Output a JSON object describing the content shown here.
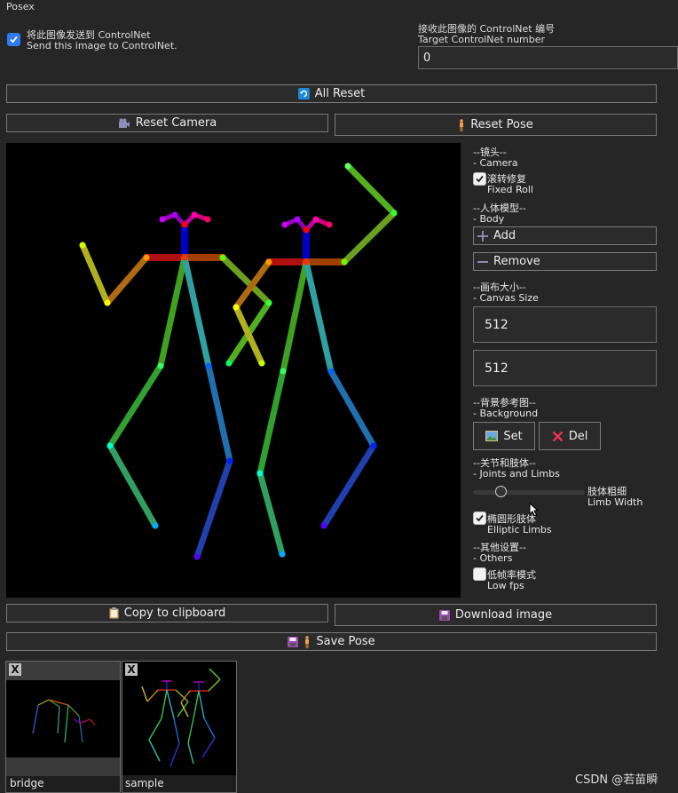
{
  "top": {
    "title_fragment": "Posex",
    "send_checkbox": {
      "label_cn": "将此图像发送到 ControlNet",
      "label_en": "Send this image to ControlNet.",
      "checked": true
    },
    "target_label_cn": "接收此图像的 ControlNet 编号",
    "target_label_en": "Target ControlNet number",
    "target_value": "0"
  },
  "buttons": {
    "all_reset": "All Reset",
    "reset_camera": "Reset Camera",
    "reset_pose": "Reset Pose",
    "copy_clipboard": "Copy to clipboard",
    "download_image": "Download image",
    "save_pose": "Save Pose"
  },
  "controls": {
    "camera": {
      "cn": "--镜头--",
      "en": "- Camera"
    },
    "fixed_roll": {
      "cn": "滚转修复",
      "en": "Fixed Roll",
      "checked": true
    },
    "body": {
      "cn": "--人体模型--",
      "en": "- Body"
    },
    "add": "Add",
    "remove": "Remove",
    "canvas_size": {
      "cn": "--画布大小--",
      "en": "- Canvas Size",
      "width": "512",
      "height": "512"
    },
    "background": {
      "cn": "--背景参考图--",
      "en": "- Background",
      "set": "Set",
      "del": "Del"
    },
    "joints": {
      "cn": "--关节和肢体--",
      "en": "- Joints and Limbs"
    },
    "limb_width": {
      "cn": "肢体粗细",
      "en": "Limb Width",
      "value": 0.22
    },
    "elliptic": {
      "cn": "椭圆形肢体",
      "en": "Elliptic Limbs",
      "checked": true
    },
    "others": {
      "cn": "--其他设置--",
      "en": "- Others"
    },
    "low_fps": {
      "cn": "低帧率模式",
      "en": "Low fps",
      "checked": false
    }
  },
  "thumbnails": [
    {
      "name": "bridge",
      "close": "X"
    },
    {
      "name": "sample",
      "close": "X"
    }
  ],
  "watermark": "CSDN @若苗瞬",
  "icons": {
    "all_reset": "reset-icon",
    "reset_camera": "camera-icon",
    "reset_pose": "person-icon",
    "add": "plus-icon",
    "remove": "minus-icon",
    "set": "image-icon",
    "del": "cross-icon",
    "copy": "clipboard-icon",
    "download": "floppy-icon",
    "save_pose": "floppy-icon"
  }
}
